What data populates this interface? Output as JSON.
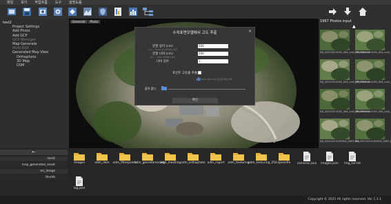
{
  "menu": [
    "파일",
    "보기",
    "작업흐름",
    "도구",
    "설명도움"
  ],
  "left_tree": {
    "root": "test2",
    "items": [
      {
        "label": "Project Settings",
        "dim": false
      },
      {
        "label": "Add Photo",
        "dim": false
      },
      {
        "label": "Add GCP",
        "dim": false
      },
      {
        "label": "GCP Manager",
        "dim": true
      },
      {
        "label": "Map Generate",
        "dim": false
      },
      {
        "label": "Multi-Edit",
        "dim": true
      },
      {
        "label": "Generated Map View",
        "dim": false
      }
    ],
    "sub_items": [
      "Orthophoto",
      "3D Map",
      "DSM"
    ]
  },
  "canvas_tabs": [
    "Generate",
    "Photo"
  ],
  "dialog": {
    "title": "수치표면모델에서 고도 추출",
    "fields": [
      {
        "label": "분할 깊이 (cm)",
        "sub": "0m ~ 100m cm 마커에서 측정",
        "value": "500"
      },
      {
        "label": "분할 너비 (cm)",
        "sub": "0m ~ 100m 마커에서 측정",
        "value": "200"
      },
      {
        "label": "너비 점수",
        "sub": "",
        "value": "1"
      }
    ],
    "checkbox_label": "포인트 고유출 추출",
    "checkbox_note": "DSM, 분석 DSM 포인트 파일 출력",
    "output_label": "출력 폴더",
    "ok_button": "확인"
  },
  "right_panel": {
    "title": "1967 Photos input",
    "thumbnails": [
      {
        "caption": "DJI_20221014130_004_rca1_PPKMSdiutu"
      },
      {
        "caption": "DJI_20221014130_004_rca1_PPKMSdiutu"
      },
      {
        "caption": "DJI_20221014130_004_rca1_PPKMSdiutu"
      },
      {
        "caption": "DJI_20221014130_004_rca1_PPKMSdiutu"
      },
      {
        "caption": "DJI_20221014130_004_rca1_PPKMSdiutu"
      },
      {
        "caption": "DJI_20221014130_004_rca1_Trixeterny"
      },
      {
        "caption": "DJI_20221014130504_0001.JPG"
      },
      {
        "caption": "DJI_20221014130504_0001.JPG"
      }
    ]
  },
  "bottom_left": {
    "back": "←",
    "rows": [
      "test2",
      "map_generated_result",
      "src_image",
      "thumb"
    ]
  },
  "files": [
    {
      "label": "images",
      "type": "folder"
    },
    {
      "label": "odm_dem",
      "type": "folder"
    },
    {
      "label": "odm_filterpoints",
      "type": "folder"
    },
    {
      "label": "odm_georeferencing",
      "type": "folder"
    },
    {
      "label": "odm_meshing",
      "type": "folder"
    },
    {
      "label": "odm_orthophoto",
      "type": "folder"
    },
    {
      "label": "odm_report",
      "type": "folder"
    },
    {
      "label": "odm_texturing",
      "type": "folder"
    },
    {
      "label": "odm_texturing_25d",
      "type": "folder"
    },
    {
      "label": "opensfm",
      "type": "folder"
    },
    {
      "label": "cameras.json",
      "type": "file"
    },
    {
      "label": "images.json",
      "type": "file"
    },
    {
      "label": "img_list.txt",
      "type": "file"
    },
    {
      "label": "log.json",
      "type": "file"
    }
  ],
  "copyright": "Copyright © 2021 All rights reserved. Ver 1.1.1",
  "colors": {
    "folder": "#e8b43a",
    "accent": "#5a8fd8"
  }
}
